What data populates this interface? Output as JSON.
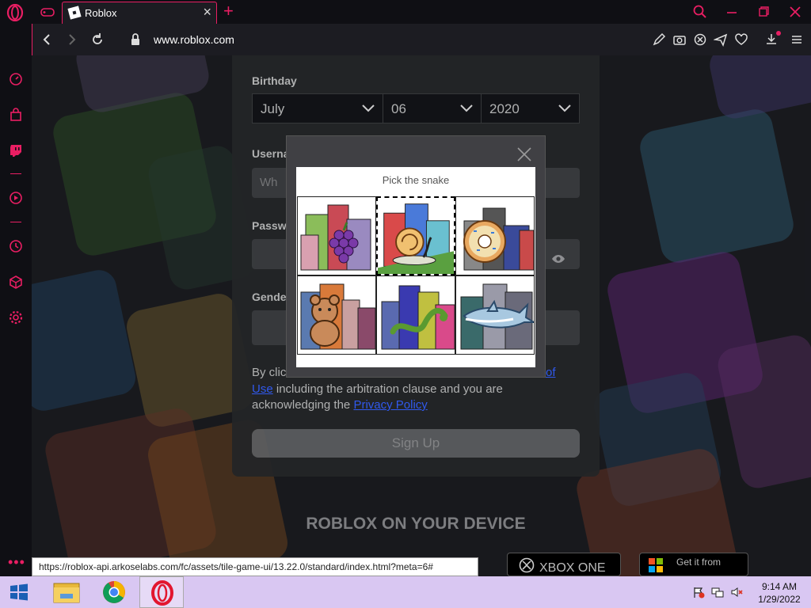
{
  "browser": {
    "tab_title": "Roblox",
    "url": "www.roblox.com",
    "accent_color": "#e91e63"
  },
  "signup": {
    "birthday_label": "Birthday",
    "month": "July",
    "day": "06",
    "year": "2020",
    "username_label": "Userna",
    "username_placeholder": "Wh",
    "password_label": "Passwo",
    "gender_label": "Gende",
    "legal_text_1": "By clic",
    "legal_link_1a": "of",
    "legal_link_1b": "Use",
    "legal_text_2": " including the arbitration clause and you are acknowledging the ",
    "legal_link_2": "Privacy Policy",
    "signup_button": "Sign Up"
  },
  "device_section": {
    "heading": "ROBLOX ON YOUR DEVICE",
    "xbox_label": "XBOX ONE",
    "microsoft_label": "Get it from"
  },
  "captcha": {
    "instruction": "Pick the snake",
    "tiles": [
      {
        "subject": "grapes",
        "selected": false
      },
      {
        "subject": "snail",
        "selected": true
      },
      {
        "subject": "donut",
        "selected": false
      },
      {
        "subject": "teddy-bear",
        "selected": false
      },
      {
        "subject": "snake",
        "selected": false
      },
      {
        "subject": "shark",
        "selected": false
      }
    ]
  },
  "status_url": "https://roblox-api.arkoselabs.com/fc/assets/tile-game-ui/13.22.0/standard/index.html?meta=6#",
  "taskbar": {
    "time": "9:14 AM",
    "date": "1/29/2022",
    "apps": [
      "file-explorer",
      "chrome",
      "opera"
    ]
  }
}
